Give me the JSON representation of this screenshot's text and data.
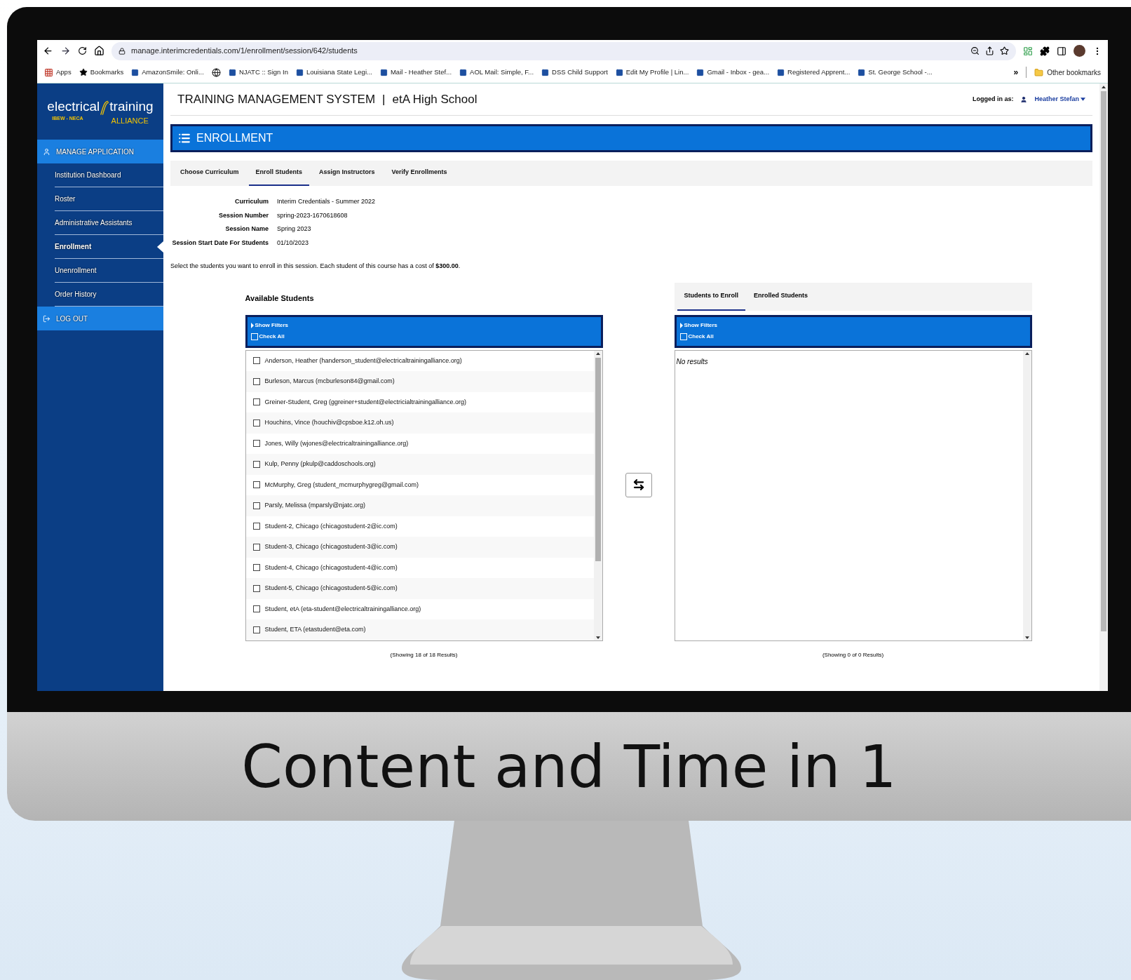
{
  "browser": {
    "url": "manage.interimcredentials.com/1/enrollment/session/642/students",
    "bookmarks": [
      {
        "label": "Apps",
        "kind": "apps"
      },
      {
        "label": "Bookmarks",
        "kind": "star"
      },
      {
        "label": "AmazonSmile: Onli...",
        "kind": "site"
      },
      {
        "kind": "globe"
      },
      {
        "label": "NJATC :: Sign In",
        "kind": "site"
      },
      {
        "label": "Louisiana State Legi...",
        "kind": "site"
      },
      {
        "label": "Mail - Heather Stef...",
        "kind": "site"
      },
      {
        "label": "AOL Mail: Simple, F...",
        "kind": "site"
      },
      {
        "label": "DSS Child Support",
        "kind": "site"
      },
      {
        "label": "Edit My Profile | Lin...",
        "kind": "site"
      },
      {
        "label": "Gmail - Inbox - gea...",
        "kind": "site"
      },
      {
        "label": "Registered Apprent...",
        "kind": "site"
      },
      {
        "label": "St. George School -...",
        "kind": "site"
      }
    ],
    "overflow": "»",
    "other_bookmarks": "Other bookmarks"
  },
  "sidebar": {
    "logo": {
      "word1": "electrical",
      "word2": "training",
      "tag": "IBEW - NECA",
      "sub": "ALLIANCE"
    },
    "items": [
      {
        "label": "MANAGE APPLICATION",
        "kind": "section",
        "selected": false
      },
      {
        "label": "Institution Dashboard",
        "kind": "link",
        "selected": false
      },
      {
        "label": "Roster",
        "kind": "link",
        "selected": false
      },
      {
        "label": "Administrative Assistants",
        "kind": "link",
        "selected": false
      },
      {
        "label": "Enrollment",
        "kind": "link",
        "selected": true
      },
      {
        "label": "Unenrollment",
        "kind": "link",
        "selected": false
      },
      {
        "label": "Order History",
        "kind": "link",
        "selected": false
      },
      {
        "label": "LOG OUT",
        "kind": "logout",
        "selected": false
      }
    ]
  },
  "header": {
    "title": "TRAINING MANAGEMENT SYSTEM",
    "separator": "|",
    "school": "etA High School",
    "logged_in_label": "Logged in as:",
    "user": "Heather Stefan"
  },
  "section_title": "ENROLLMENT",
  "steps": [
    {
      "label": "Choose Curriculum",
      "selected": false
    },
    {
      "label": "Enroll Students",
      "selected": true
    },
    {
      "label": "Assign Instructors",
      "selected": false
    },
    {
      "label": "Verify Enrollments",
      "selected": false
    }
  ],
  "details": [
    {
      "label": "Curriculum",
      "value": "Interim Credentials - Summer 2022"
    },
    {
      "label": "Session Number",
      "value": "spring-2023-1670618608"
    },
    {
      "label": "Session Name",
      "value": "Spring 2023"
    },
    {
      "label": "Session Start Date For Students",
      "value": "01/10/2023"
    }
  ],
  "instruction": "Select the students you want to enroll in this session. Each student of this course has a cost of **$300.00**.",
  "available": {
    "title": "Available Students",
    "show_filters": "Show Filters",
    "check_all": "Check All",
    "check_all_checked": false,
    "students": [
      {
        "label": "Anderson, Heather (handerson_student@electricaltrainingalliance.org)",
        "checked": false
      },
      {
        "label": "Burleson, Marcus (mcburleson84@gmail.com)",
        "checked": false
      },
      {
        "label": "Greiner-Student, Greg (ggreiner+student@electricialtrainingalliance.org)",
        "checked": false
      },
      {
        "label": "Houchins, Vince (houchiv@cpsboe.k12.oh.us)",
        "checked": false
      },
      {
        "label": "Jones, Willy (wjones@electricaltrainingalliance.org)",
        "checked": false
      },
      {
        "label": "Kulp, Penny (pkulp@caddoschools.org)",
        "checked": false
      },
      {
        "label": "McMurphy, Greg (student_mcmurphygreg@gmail.com)",
        "checked": false
      },
      {
        "label": "Parsly, Melissa (mparsly@njatc.org)",
        "checked": false
      },
      {
        "label": "Student-2, Chicago (chicagostudent-2@ic.com)",
        "checked": false
      },
      {
        "label": "Student-3, Chicago (chicagostudent-3@ic.com)",
        "checked": false
      },
      {
        "label": "Student-4, Chicago (chicagostudent-4@ic.com)",
        "checked": false
      },
      {
        "label": "Student-5, Chicago (chicagostudent-5@ic.com)",
        "checked": false
      },
      {
        "label": "Student, etA (eta-student@electricaltrainingalliance.org)",
        "checked": false
      },
      {
        "label": "Student, ETA (etastudent@eta.com)",
        "checked": false
      }
    ],
    "footer": "(Showing 18 of 18 Results)"
  },
  "enroll": {
    "tabs": [
      {
        "label": "Students to Enroll",
        "selected": true
      },
      {
        "label": "Enrolled Students",
        "selected": false
      }
    ],
    "show_filters": "Show Filters",
    "check_all": "Check All",
    "check_all_checked": false,
    "empty": "No results",
    "footer": "(Showing 0 of 0 Results)"
  },
  "caption": "Content and Time in 1"
}
